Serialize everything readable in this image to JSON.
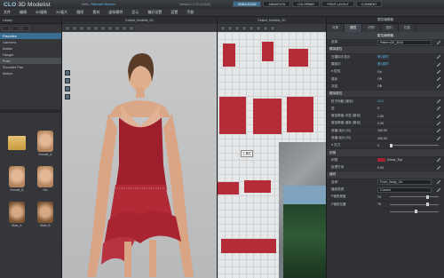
{
  "app": {
    "title_prefix": "CLO",
    "title": "3D Modelist",
    "hello": "Hello,",
    "user": "Fitfemale Member",
    "version_label": "Version",
    "version": "2.2.70",
    "build": "(11240)"
  },
  "modes": [
    "SIMULATION",
    "ANIMATION",
    "COLORWAY",
    "PRINT LAYOUT",
    "COMMENT"
  ],
  "menu": [
    "文件",
    "编辑",
    "3D服装",
    "2D板片",
    "缝纫",
    "素材",
    "虚拟模特",
    "显示",
    "偏好设置",
    "设置",
    "手册"
  ],
  "left": {
    "header": "Library",
    "items": [
      "Favorites",
      "Garment",
      "Avatar",
      "Hanger",
      "Pose",
      "Shoulder Pad",
      "Motion"
    ],
    "thumbs": [
      "..",
      "Female_A",
      "Female_B",
      "Kid",
      "Male_A",
      "Male_B"
    ]
  },
  "view3d_title": "Default_Modelist_3D",
  "view2d_title": "Default_Modelist_2D",
  "popup": "工具栏",
  "right": {
    "header": "属性编辑器",
    "tabs": [
      "对象",
      "属性",
      "织物",
      "纽扣",
      "拉链"
    ],
    "sub": "属性编辑器",
    "rows": [
      {
        "type": "row",
        "label": "选择",
        "value": "Pattern2D_3044",
        "style": "box"
      },
      {
        "type": "sec",
        "label": "模拟属性"
      },
      {
        "type": "row",
        "label": "在模拟中显示",
        "value": "第1原样",
        "style": "blue"
      },
      {
        "type": "row",
        "label": "模拟中",
        "value": "第1原样",
        "style": "blue"
      },
      {
        "type": "row",
        "label": "● 粒性",
        "value": "On"
      },
      {
        "type": "row",
        "label": "强化",
        "value": "Off"
      },
      {
        "type": "row",
        "label": "冻结",
        "value": "Off"
      },
      {
        "type": "sec",
        "label": "模拟属性"
      },
      {
        "type": "row",
        "label": "粒子间距 [毫米]",
        "value": "20.0",
        "style": "blue"
      },
      {
        "type": "row",
        "label": "层",
        "value": "0"
      },
      {
        "type": "row",
        "label": "增加厚度-冲突 [毫米]",
        "value": "1.00"
      },
      {
        "type": "row",
        "label": "增加厚度-渲染 [毫米]",
        "value": "0.00"
      },
      {
        "type": "row",
        "label": "收缩-纬纱 [%]",
        "value": "100.00"
      },
      {
        "type": "row",
        "label": "收缩-经纱 [%]",
        "value": "100.00"
      },
      {
        "type": "row",
        "label": "● 压力",
        "value": "0",
        "style": "slider"
      },
      {
        "type": "sec",
        "label": "织物"
      },
      {
        "type": "row",
        "label": "织物",
        "value": "Dress_Top",
        "style": "swatch"
      },
      {
        "type": "row",
        "label": "纹理方向",
        "value": "0.00"
      },
      {
        "type": "sec",
        "label": "缝线"
      },
      {
        "type": "row",
        "label": "名称",
        "value": "Front_Body_Ctr",
        "style": "box"
      },
      {
        "type": "row",
        "label": "缝纫类型",
        "value": "Curved",
        "style": "box"
      },
      {
        "type": "row",
        "label": "F轴的宽度",
        "value": "74",
        "style": "slider"
      },
      {
        "type": "row",
        "label": "F轴的位置",
        "value": "75",
        "style": "slider"
      },
      {
        "type": "row",
        "label": "",
        "value": "",
        "style": "slider"
      }
    ]
  }
}
